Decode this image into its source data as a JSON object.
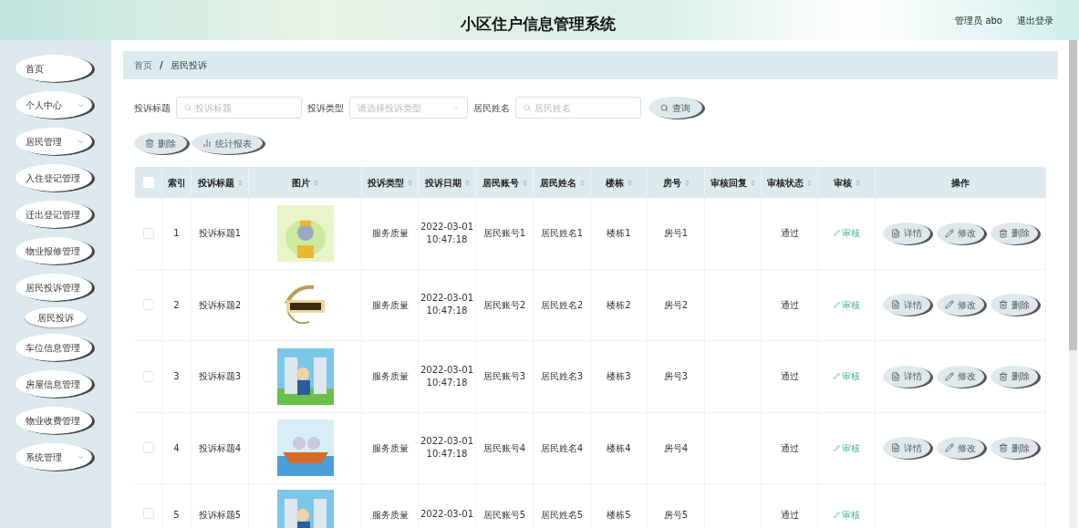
{
  "header": {
    "title": "小区住户信息管理系统",
    "user": "管理员 abo",
    "logout": "退出登录"
  },
  "sidebar": {
    "items": [
      {
        "label": "首页",
        "has_submenu": false
      },
      {
        "label": "个人中心",
        "has_submenu": true
      },
      {
        "label": "居民管理",
        "has_submenu": true
      },
      {
        "label": "入住登记管理",
        "has_submenu": false
      },
      {
        "label": "迁出登记管理",
        "has_submenu": false
      },
      {
        "label": "物业报修管理",
        "has_submenu": false
      },
      {
        "label": "居民投诉管理",
        "has_submenu": false,
        "children": [
          {
            "label": "居民投诉",
            "selected": true
          }
        ]
      },
      {
        "label": "车位信息管理",
        "has_submenu": false
      },
      {
        "label": "房屋信息管理",
        "has_submenu": false
      },
      {
        "label": "物业收费管理",
        "has_submenu": false
      },
      {
        "label": "系统管理",
        "has_submenu": true
      }
    ]
  },
  "breadcrumb": {
    "separator": "/",
    "items": [
      "首页",
      "居民投诉"
    ]
  },
  "search": {
    "fields": [
      {
        "label": "投诉标题",
        "kind": "text",
        "placeholder": "投诉标题"
      },
      {
        "label": "投诉类型",
        "kind": "select",
        "placeholder": "请选择投诉类型"
      },
      {
        "label": "居民姓名",
        "kind": "text",
        "placeholder": "居民姓名"
      }
    ],
    "button": "查询"
  },
  "actions": [
    {
      "label": "删除",
      "kind": "delete"
    },
    {
      "label": "统计报表",
      "kind": "chart"
    }
  ],
  "table": {
    "all_checked": false,
    "columns": [
      {
        "label": "索引",
        "sortable": false
      },
      {
        "label": "投诉标题",
        "sortable": true
      },
      {
        "label": "图片",
        "sortable": true
      },
      {
        "label": "投诉类型",
        "sortable": true
      },
      {
        "label": "投诉日期",
        "sortable": true
      },
      {
        "label": "居民账号",
        "sortable": true
      },
      {
        "label": "居民姓名",
        "sortable": true
      },
      {
        "label": "楼栋",
        "sortable": true
      },
      {
        "label": "房号",
        "sortable": true
      },
      {
        "label": "审核回复",
        "sortable": true
      },
      {
        "label": "审核状态",
        "sortable": true
      },
      {
        "label": "审核",
        "sortable": true
      },
      {
        "label": "操作",
        "sortable": false
      }
    ],
    "rows": [
      {
        "checked": false,
        "index": "1",
        "title": "投诉标题1",
        "type": "服务质量",
        "date": "2022-03-01",
        "time": "10:47:18",
        "account": "居民账号1",
        "name": "居民姓名1",
        "building": "楼栋1",
        "room": "房号1",
        "status": "通过",
        "review": "审核",
        "buttons": [
          {
            "label": "详情",
            "kind": "detail"
          },
          {
            "label": "修改",
            "kind": "edit"
          },
          {
            "label": "删除",
            "kind": "delete"
          }
        ]
      },
      {
        "checked": false,
        "index": "2",
        "title": "投诉标题2",
        "type": "服务质量",
        "date": "2022-03-01",
        "time": "10:47:18",
        "account": "居民账号2",
        "name": "居民姓名2",
        "building": "楼栋2",
        "room": "房号2",
        "status": "通过",
        "review": "审核",
        "buttons": [
          {
            "label": "详情",
            "kind": "detail"
          },
          {
            "label": "修改",
            "kind": "edit"
          },
          {
            "label": "删除",
            "kind": "delete"
          }
        ]
      },
      {
        "checked": false,
        "index": "3",
        "title": "投诉标题3",
        "type": "服务质量",
        "date": "2022-03-01",
        "time": "10:47:18",
        "account": "居民账号3",
        "name": "居民姓名3",
        "building": "楼栋3",
        "room": "房号3",
        "status": "通过",
        "review": "审核",
        "buttons": [
          {
            "label": "详情",
            "kind": "detail"
          },
          {
            "label": "修改",
            "kind": "edit"
          },
          {
            "label": "删除",
            "kind": "delete"
          }
        ]
      },
      {
        "checked": false,
        "index": "4",
        "title": "投诉标题4",
        "type": "服务质量",
        "date": "2022-03-01",
        "time": "10:47:18",
        "account": "居民账号4",
        "name": "居民姓名4",
        "building": "楼栋4",
        "room": "房号4",
        "status": "通过",
        "review": "审核",
        "buttons": [
          {
            "label": "详情",
            "kind": "detail"
          },
          {
            "label": "修改",
            "kind": "edit"
          },
          {
            "label": "删除",
            "kind": "delete"
          }
        ]
      },
      {
        "checked": false,
        "index": "5",
        "title": "投诉标题5",
        "type": "服务质量",
        "date": "2022-03-01",
        "account": "居民账号5",
        "name": "居民姓名5",
        "building": "楼栋5",
        "room": "房号5",
        "status": "通过",
        "review": "审核"
      }
    ]
  }
}
